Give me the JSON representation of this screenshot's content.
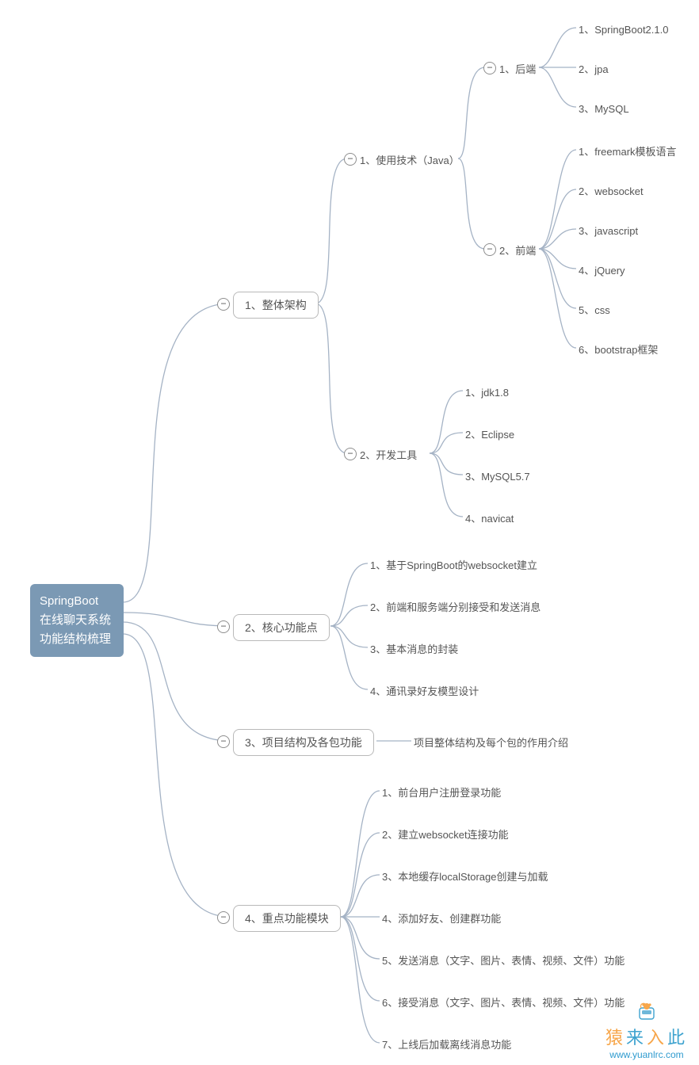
{
  "root": {
    "line1": "SpringBoot",
    "line2": "在线聊天系统",
    "line3": "功能结构梳理"
  },
  "n1": "1、整体架构",
  "n1_1": "1、使用技术（Java）",
  "n1_1_1": "1、后端",
  "n1_1_1_items": {
    "a": "1、SpringBoot2.1.0",
    "b": "2、jpa",
    "c": "3、MySQL"
  },
  "n1_1_2": "2、前端",
  "n1_1_2_items": {
    "a": "1、freemark模板语言",
    "b": "2、websocket",
    "c": "3、javascript",
    "d": "4、jQuery",
    "e": "5、css",
    "f": "6、bootstrap框架"
  },
  "n1_2": "2、开发工具",
  "n1_2_items": {
    "a": "1、jdk1.8",
    "b": "2、Eclipse",
    "c": "3、MySQL5.7",
    "d": "4、navicat"
  },
  "n2": "2、核心功能点",
  "n2_items": {
    "a": "1、基于SpringBoot的websocket建立",
    "b": "2、前端和服务端分别接受和发送消息",
    "c": "3、基本消息的封装",
    "d": "4、通讯录好友模型设计"
  },
  "n3": "3、项目结构及各包功能",
  "n3_leaf": "项目整体结构及每个包的作用介绍",
  "n4": "4、重点功能模块",
  "n4_items": {
    "a": "1、前台用户注册登录功能",
    "b": "2、建立websocket连接功能",
    "c": "3、本地缓存localStorage创建与加载",
    "d": "4、添加好友、创建群功能",
    "e": "5、发送消息（文字、图片、表情、视频、文件）功能",
    "f": "6、接受消息（文字、图片、表情、视频、文件）功能",
    "g": "7、上线后加载离线消息功能"
  },
  "watermark": {
    "text": "猿来入此",
    "url": "www.yuanlrc.com"
  }
}
